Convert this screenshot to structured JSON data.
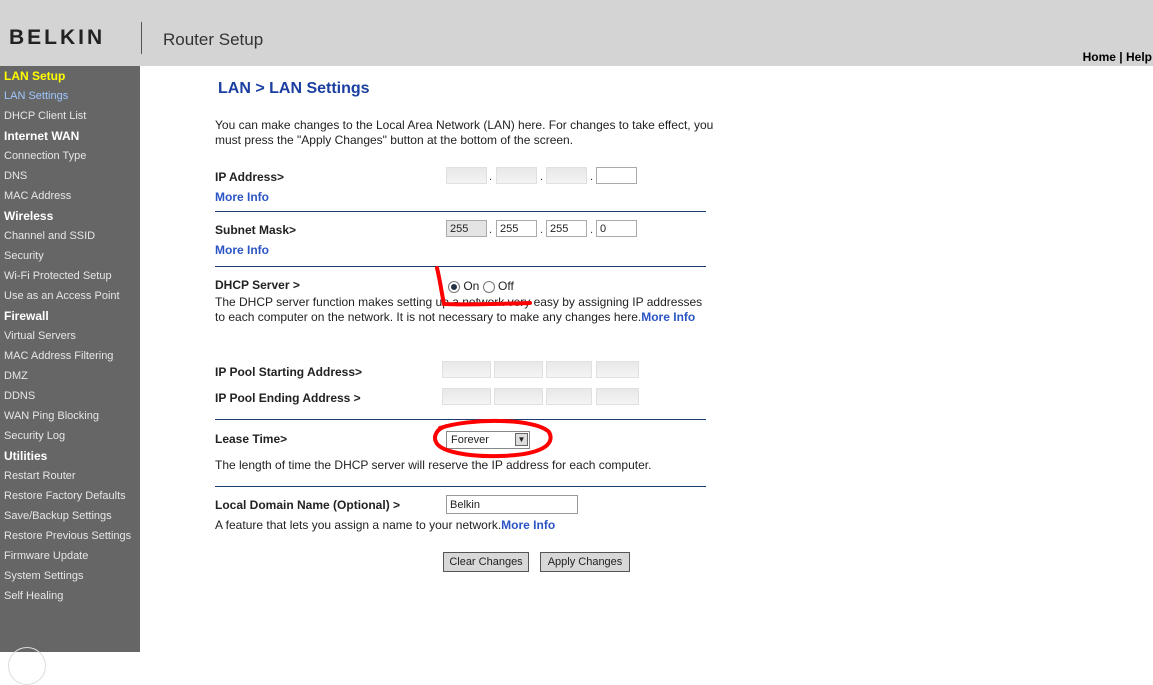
{
  "header": {
    "logo": "BELKIN",
    "title": "Router Setup",
    "home_link": "Home",
    "link_separator": "|",
    "help_link": "Help"
  },
  "sidebar": {
    "sections": [
      {
        "heading": "LAN Setup",
        "active": true,
        "items": [
          "LAN Settings",
          "DHCP Client List"
        ]
      },
      {
        "heading": "Internet WAN",
        "items": [
          "Connection Type",
          "DNS",
          "MAC Address"
        ]
      },
      {
        "heading": "Wireless",
        "items": [
          "Channel and SSID",
          "Security",
          "Wi-Fi Protected Setup",
          "Use as an Access Point"
        ]
      },
      {
        "heading": "Firewall",
        "items": [
          "Virtual Servers",
          "MAC Address Filtering",
          "DMZ",
          "DDNS",
          "WAN Ping Blocking",
          "Security Log"
        ]
      },
      {
        "heading": "Utilities",
        "items": [
          "Restart Router",
          "Restore Factory Defaults",
          "Save/Backup Settings",
          "Restore Previous Settings",
          "Firmware Update",
          "System Settings",
          "Self Healing"
        ]
      }
    ],
    "active_item": "LAN Settings"
  },
  "main": {
    "title": "LAN > LAN Settings",
    "intro": "You can make changes to the Local Area Network (LAN) here. For changes to take effect, you must press the \"Apply Changes\" button at the bottom of the screen.",
    "ip_address": {
      "label": "IP Address>",
      "more_info": "More Info",
      "octets": [
        "",
        "",
        "",
        ""
      ]
    },
    "subnet_mask": {
      "label": "Subnet Mask>",
      "more_info": "More Info",
      "octets": [
        "255",
        "255",
        "255",
        "0"
      ]
    },
    "dhcp_server": {
      "label": "DHCP Server  >",
      "on_label": "On",
      "off_label": "Off",
      "selected": "On",
      "description": "The DHCP server function makes setting up a network very easy by assigning IP addresses to each computer on the network. It is not necessary to make any changes here.",
      "more_info": "More Info"
    },
    "ip_pool_start": {
      "label": "IP Pool Starting Address>",
      "octets": [
        "",
        "",
        "",
        ""
      ]
    },
    "ip_pool_end": {
      "label": "IP Pool Ending Address >",
      "octets": [
        "",
        "",
        "",
        ""
      ]
    },
    "lease_time": {
      "label": "Lease Time>",
      "value": "Forever",
      "description": "The length of time the DHCP server will reserve the IP address for each computer."
    },
    "local_domain": {
      "label": "Local Domain Name  (Optional) >",
      "value": "Belkin",
      "description": "A feature that lets you assign a name to your network.",
      "more_info": "More Info"
    },
    "buttons": {
      "clear": "Clear Changes",
      "apply": "Apply Changes"
    }
  },
  "colors": {
    "sidebar_bg": "#666666",
    "header_bg": "#d4d4d4",
    "title_blue": "#1a3fa0",
    "link_blue": "#2b55c4",
    "active_heading": "#ffff00",
    "annotation_red": "#ff0000"
  }
}
